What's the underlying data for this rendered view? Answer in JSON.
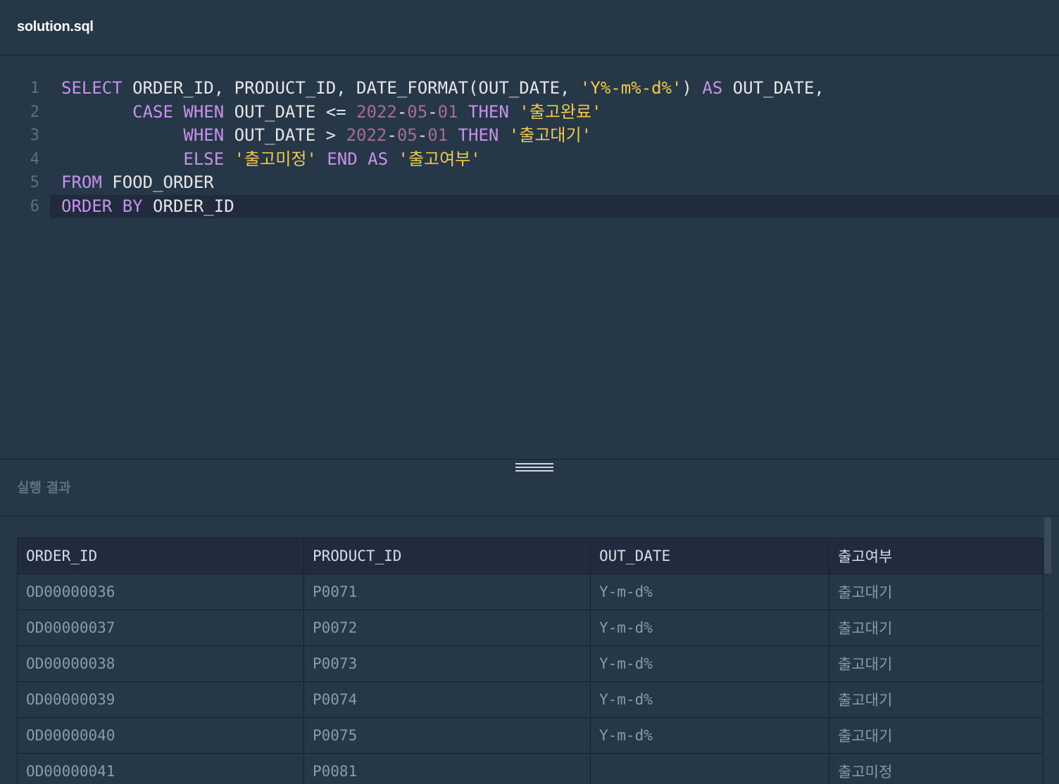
{
  "tab": {
    "title": "solution.sql"
  },
  "editor": {
    "lines": [
      {
        "num": "1",
        "tokens": [
          {
            "t": "kw",
            "v": "SELECT"
          },
          {
            "t": "plain",
            "v": " ORDER_ID, PRODUCT_ID, DATE_FORMAT(OUT_DATE, "
          },
          {
            "t": "str",
            "v": "'Y%-m%-d%'"
          },
          {
            "t": "plain",
            "v": ") "
          },
          {
            "t": "kw",
            "v": "AS"
          },
          {
            "t": "plain",
            "v": " OUT_DATE,"
          }
        ]
      },
      {
        "num": "2",
        "tokens": [
          {
            "t": "plain",
            "v": "       "
          },
          {
            "t": "kw",
            "v": "CASE"
          },
          {
            "t": "plain",
            "v": " "
          },
          {
            "t": "kw",
            "v": "WHEN"
          },
          {
            "t": "plain",
            "v": " OUT_DATE <= "
          },
          {
            "t": "num",
            "v": "2022"
          },
          {
            "t": "plain",
            "v": "-"
          },
          {
            "t": "num",
            "v": "05"
          },
          {
            "t": "plain",
            "v": "-"
          },
          {
            "t": "num",
            "v": "01"
          },
          {
            "t": "plain",
            "v": " "
          },
          {
            "t": "kw",
            "v": "THEN"
          },
          {
            "t": "plain",
            "v": " "
          },
          {
            "t": "str",
            "v": "'출고완료'"
          }
        ]
      },
      {
        "num": "3",
        "tokens": [
          {
            "t": "plain",
            "v": "            "
          },
          {
            "t": "kw",
            "v": "WHEN"
          },
          {
            "t": "plain",
            "v": " OUT_DATE > "
          },
          {
            "t": "num",
            "v": "2022"
          },
          {
            "t": "plain",
            "v": "-"
          },
          {
            "t": "num",
            "v": "05"
          },
          {
            "t": "plain",
            "v": "-"
          },
          {
            "t": "num",
            "v": "01"
          },
          {
            "t": "plain",
            "v": " "
          },
          {
            "t": "kw",
            "v": "THEN"
          },
          {
            "t": "plain",
            "v": " "
          },
          {
            "t": "str",
            "v": "'출고대기'"
          }
        ]
      },
      {
        "num": "4",
        "tokens": [
          {
            "t": "plain",
            "v": "            "
          },
          {
            "t": "kw",
            "v": "ELSE"
          },
          {
            "t": "plain",
            "v": " "
          },
          {
            "t": "str",
            "v": "'출고미정'"
          },
          {
            "t": "plain",
            "v": " "
          },
          {
            "t": "kw",
            "v": "END"
          },
          {
            "t": "plain",
            "v": " "
          },
          {
            "t": "kw",
            "v": "AS"
          },
          {
            "t": "plain",
            "v": " "
          },
          {
            "t": "str",
            "v": "'출고여부'"
          }
        ]
      },
      {
        "num": "5",
        "tokens": [
          {
            "t": "kw",
            "v": "FROM"
          },
          {
            "t": "plain",
            "v": " FOOD_ORDER"
          }
        ]
      },
      {
        "num": "6",
        "active": true,
        "tokens": [
          {
            "t": "kw",
            "v": "ORDER"
          },
          {
            "t": "plain",
            "v": " "
          },
          {
            "t": "kw",
            "v": "BY"
          },
          {
            "t": "plain",
            "v": " ORDER_ID"
          }
        ]
      }
    ]
  },
  "results": {
    "title": "실행 결과",
    "columns": [
      "ORDER_ID",
      "PRODUCT_ID",
      "OUT_DATE",
      "출고여부"
    ],
    "rows": [
      [
        "OD00000036",
        "P0071",
        "Y-m-d%",
        "출고대기"
      ],
      [
        "OD00000037",
        "P0072",
        "Y-m-d%",
        "출고대기"
      ],
      [
        "OD00000038",
        "P0073",
        "Y-m-d%",
        "출고대기"
      ],
      [
        "OD00000039",
        "P0074",
        "Y-m-d%",
        "출고대기"
      ],
      [
        "OD00000040",
        "P0075",
        "Y-m-d%",
        "출고대기"
      ],
      [
        "OD00000041",
        "P0081",
        "",
        "출고미정"
      ]
    ]
  },
  "colors": {
    "background": "#263747",
    "keyword": "#c792ea",
    "string": "#f2c94c",
    "number": "#a46c9b",
    "active_line": "#202b3d"
  }
}
